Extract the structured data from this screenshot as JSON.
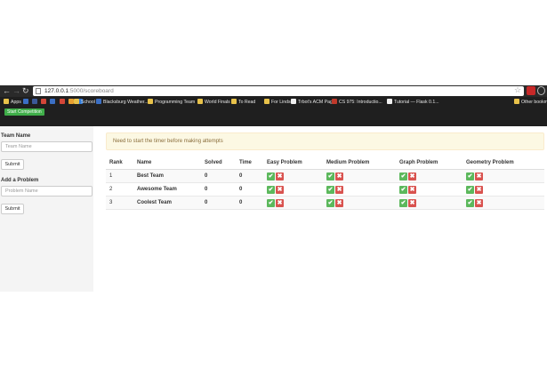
{
  "browser": {
    "url_host": "127.0.0.1",
    "url_path": ":5000/scoreboard",
    "bookmarks": [
      {
        "label": "Apps",
        "icon": "apps-grid-icon",
        "color": "#e8c24a"
      },
      {
        "label": "",
        "icon": "bookmark-icon-1",
        "color": "#3b6fc4"
      },
      {
        "label": "",
        "icon": "facebook-icon",
        "color": "#3b5998"
      },
      {
        "label": "",
        "icon": "gmail-icon",
        "color": "#d44638"
      },
      {
        "label": "",
        "icon": "calendar-icon",
        "color": "#3b6fc4"
      },
      {
        "label": "",
        "icon": "bookmark-icon-5",
        "color": "#d44638"
      },
      {
        "label": "",
        "icon": "bookmark-icon-6",
        "color": "#e8a030"
      },
      {
        "label": "",
        "icon": "bookmark-icon-7",
        "color": "#2f7ad8"
      },
      {
        "label": "School",
        "icon": "folder-icon",
        "color": "#e8c24a"
      },
      {
        "label": "Blacksburg Weather...",
        "icon": "weather-icon",
        "color": "#3b6fc4"
      },
      {
        "label": "Programming Team",
        "icon": "folder-icon",
        "color": "#e8c24a"
      },
      {
        "label": "World Finals",
        "icon": "folder-icon",
        "color": "#e8c24a"
      },
      {
        "label": "To Read",
        "icon": "folder-icon",
        "color": "#e8c24a"
      },
      {
        "label": "For Lindsey",
        "icon": "folder-icon",
        "color": "#e8c24a"
      },
      {
        "label": "Trbot's ACM Page",
        "icon": "page-icon",
        "color": "#f0f0f0"
      },
      {
        "label": "CS 975: Introductio...",
        "icon": "page-icon",
        "color": "#c0392b"
      },
      {
        "label": "Tutorial — Flask 0.1...",
        "icon": "page-icon",
        "color": "#f0f0f0"
      },
      {
        "label": "Other bookm",
        "icon": "folder-icon",
        "color": "#e8c24a"
      }
    ]
  },
  "navbar": {
    "start_label": "Start Competition",
    "start_color": "#3fae49"
  },
  "sidebar": {
    "team_heading": "Team Name",
    "team_placeholder": "Team Name",
    "team_submit": "Submit",
    "problem_heading": "Add a Problem",
    "problem_placeholder": "Problem Name",
    "problem_submit": "Submit"
  },
  "alert": {
    "text": "Need to start the timer before making attempts",
    "bg": "#fcf8e3",
    "color": "#8a6d3b"
  },
  "scoreboard": {
    "headers": [
      "Rank",
      "Name",
      "Solved",
      "Time",
      "Easy Problem",
      "Medium Problem",
      "Graph Problem",
      "Geometry Problem"
    ],
    "rows": [
      {
        "rank": "1",
        "name": "Best Team",
        "solved": "0",
        "time": "0"
      },
      {
        "rank": "2",
        "name": "Awesome Team",
        "solved": "0",
        "time": "0"
      },
      {
        "rank": "3",
        "name": "Coolest Team",
        "solved": "0",
        "time": "0"
      }
    ],
    "accept_icon": "check-icon",
    "reject_icon": "close-icon",
    "accept_color": "#5cb85c",
    "reject_color": "#d9534f"
  }
}
